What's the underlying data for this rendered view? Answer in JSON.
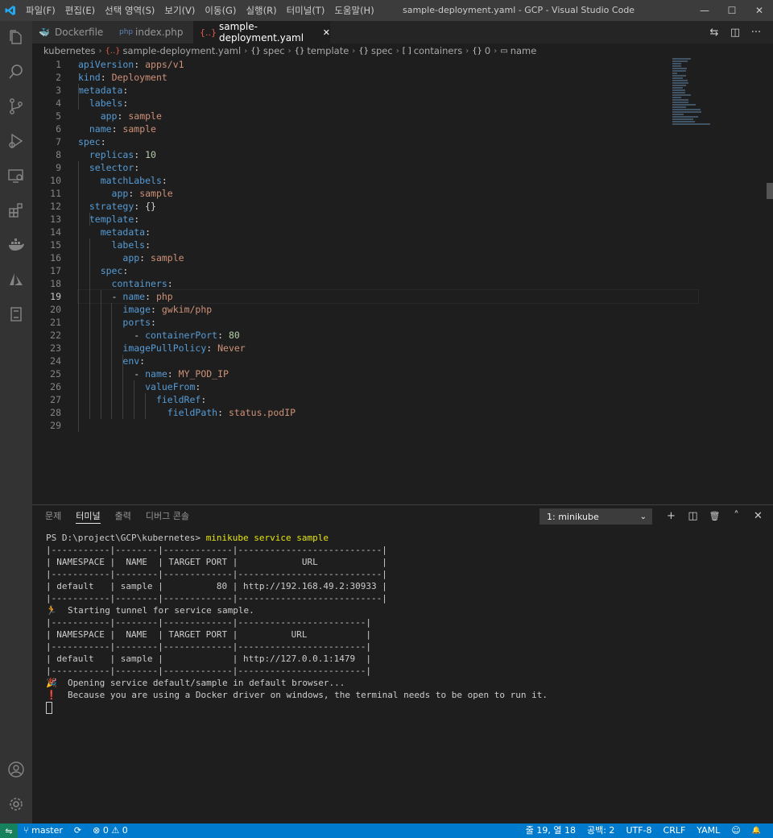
{
  "window": {
    "title": "sample-deployment.yaml - GCP - Visual Studio Code",
    "menu": [
      "파일(F)",
      "편집(E)",
      "선택 영역(S)",
      "보기(V)",
      "이동(G)",
      "실행(R)",
      "터미널(T)",
      "도움말(H)"
    ],
    "controls": {
      "minimize": "—",
      "maximize": "☐",
      "close": "✕"
    }
  },
  "activity_bar": [
    "files-icon",
    "search-icon",
    "source-control-icon",
    "run-debug-icon",
    "remote-explorer-icon",
    "extensions-icon",
    "docker-icon",
    "azure-icon",
    "book-icon",
    "account-icon",
    "settings-gear-icon"
  ],
  "tabs": [
    {
      "label": "Dockerfile",
      "icon": "docker-icon",
      "glyph": "🐳",
      "active": false
    },
    {
      "label": "index.php",
      "icon": "php-icon",
      "glyph": "php",
      "active": false
    },
    {
      "label": "sample-deployment.yaml",
      "icon": "yaml-icon",
      "glyph": "{..}",
      "active": true,
      "close": "✕"
    }
  ],
  "tab_actions": {
    "compare": "⇆",
    "split": "◫",
    "more": "···"
  },
  "breadcrumb": [
    "kubernetes",
    "sample-deployment.yaml",
    "spec",
    "template",
    "spec",
    "containers",
    "0",
    "name"
  ],
  "breadcrumb_glyphs": {
    "yaml": "{..}",
    "object": "{}",
    "array": "[ ]",
    "field": "▭"
  },
  "editor": {
    "current_line": 19,
    "lines": [
      [
        [
          "k",
          "apiVersion"
        ],
        [
          "p",
          ": "
        ],
        [
          "v",
          "apps/v1"
        ]
      ],
      [
        [
          "k",
          "kind"
        ],
        [
          "p",
          ": "
        ],
        [
          "v",
          "Deployment"
        ]
      ],
      [
        [
          "k",
          "metadata"
        ],
        [
          "p",
          ":"
        ]
      ],
      [
        [
          "p",
          "  "
        ],
        [
          "k",
          "labels"
        ],
        [
          "p",
          ":"
        ]
      ],
      [
        [
          "p",
          "    "
        ],
        [
          "k",
          "app"
        ],
        [
          "p",
          ": "
        ],
        [
          "v",
          "sample"
        ]
      ],
      [
        [
          "p",
          "  "
        ],
        [
          "k",
          "name"
        ],
        [
          "p",
          ": "
        ],
        [
          "v",
          "sample"
        ]
      ],
      [
        [
          "k",
          "spec"
        ],
        [
          "p",
          ":"
        ]
      ],
      [
        [
          "p",
          "  "
        ],
        [
          "k",
          "replicas"
        ],
        [
          "p",
          ": "
        ],
        [
          "n",
          "10"
        ]
      ],
      [
        [
          "p",
          "  "
        ],
        [
          "k",
          "selector"
        ],
        [
          "p",
          ":"
        ]
      ],
      [
        [
          "p",
          "    "
        ],
        [
          "k",
          "matchLabels"
        ],
        [
          "p",
          ":"
        ]
      ],
      [
        [
          "p",
          "      "
        ],
        [
          "k",
          "app"
        ],
        [
          "p",
          ": "
        ],
        [
          "v",
          "sample"
        ]
      ],
      [
        [
          "p",
          "  "
        ],
        [
          "k",
          "strategy"
        ],
        [
          "p",
          ": {}"
        ]
      ],
      [
        [
          "p",
          "  "
        ],
        [
          "k",
          "template"
        ],
        [
          "p",
          ":"
        ]
      ],
      [
        [
          "p",
          "    "
        ],
        [
          "k",
          "metadata"
        ],
        [
          "p",
          ":"
        ]
      ],
      [
        [
          "p",
          "      "
        ],
        [
          "k",
          "labels"
        ],
        [
          "p",
          ":"
        ]
      ],
      [
        [
          "p",
          "        "
        ],
        [
          "k",
          "app"
        ],
        [
          "p",
          ": "
        ],
        [
          "v",
          "sample"
        ]
      ],
      [
        [
          "p",
          "    "
        ],
        [
          "k",
          "spec"
        ],
        [
          "p",
          ":"
        ]
      ],
      [
        [
          "p",
          "      "
        ],
        [
          "k",
          "containers"
        ],
        [
          "p",
          ":"
        ]
      ],
      [
        [
          "p",
          "      - "
        ],
        [
          "k",
          "name"
        ],
        [
          "p",
          ": "
        ],
        [
          "v",
          "php"
        ]
      ],
      [
        [
          "p",
          "        "
        ],
        [
          "k",
          "image"
        ],
        [
          "p",
          ": "
        ],
        [
          "v",
          "gwkim/php"
        ]
      ],
      [
        [
          "p",
          "        "
        ],
        [
          "k",
          "ports"
        ],
        [
          "p",
          ":"
        ]
      ],
      [
        [
          "p",
          "          - "
        ],
        [
          "k",
          "containerPort"
        ],
        [
          "p",
          ": "
        ],
        [
          "n",
          "80"
        ]
      ],
      [
        [
          "p",
          "        "
        ],
        [
          "k",
          "imagePullPolicy"
        ],
        [
          "p",
          ": "
        ],
        [
          "v",
          "Never"
        ]
      ],
      [
        [
          "p",
          "        "
        ],
        [
          "k",
          "env"
        ],
        [
          "p",
          ":"
        ]
      ],
      [
        [
          "p",
          "          - "
        ],
        [
          "k",
          "name"
        ],
        [
          "p",
          ": "
        ],
        [
          "v",
          "MY_POD_IP"
        ]
      ],
      [
        [
          "p",
          "            "
        ],
        [
          "k",
          "valueFrom"
        ],
        [
          "p",
          ":"
        ]
      ],
      [
        [
          "p",
          "              "
        ],
        [
          "k",
          "fieldRef"
        ],
        [
          "p",
          ":"
        ]
      ],
      [
        [
          "p",
          "                "
        ],
        [
          "k",
          "fieldPath"
        ],
        [
          "p",
          ": "
        ],
        [
          "v",
          "status.podIP"
        ]
      ],
      []
    ]
  },
  "panel": {
    "tabs": [
      "문제",
      "터미널",
      "출력",
      "디버그 콘솔"
    ],
    "active_tab": "터미널",
    "terminal_select": "1: minikube",
    "actions": {
      "add": "+",
      "split": "◫",
      "trash": "🗑",
      "maximize": "˄",
      "close": "✕"
    },
    "terminal": {
      "prompt": "PS D:\\project\\GCP\\kubernetes> ",
      "command": "minikube service sample",
      "lines": [
        "|-----------|--------|-------------|---------------------------|",
        "| NAMESPACE |  NAME  | TARGET PORT |            URL            |",
        "|-----------|--------|-------------|---------------------------|",
        "| default   | sample |          80 | http://192.168.49.2:30933 |",
        "|-----------|--------|-------------|---------------------------|",
        "🏃  Starting tunnel for service sample.",
        "|-----------|--------|-------------|------------------------|",
        "| NAMESPACE |  NAME  | TARGET PORT |          URL           |",
        "|-----------|--------|-------------|------------------------|",
        "| default   | sample |             | http://127.0.0.1:1479  |",
        "|-----------|--------|-------------|------------------------|",
        "🎉  Opening service default/sample in default browser...",
        "❗  Because you are using a Docker driver on windows, the terminal needs to be open to run it."
      ]
    }
  },
  "statusbar": {
    "remote": "⇋",
    "branch": "master",
    "sync": "⟳",
    "errors": "⊗ 0",
    "warnings": "⚠ 0",
    "position": "줄 19, 열 18",
    "spaces": "공백: 2",
    "encoding": "UTF-8",
    "eol": "CRLF",
    "language": "YAML",
    "feedback": "☺",
    "bell": "🔔"
  }
}
